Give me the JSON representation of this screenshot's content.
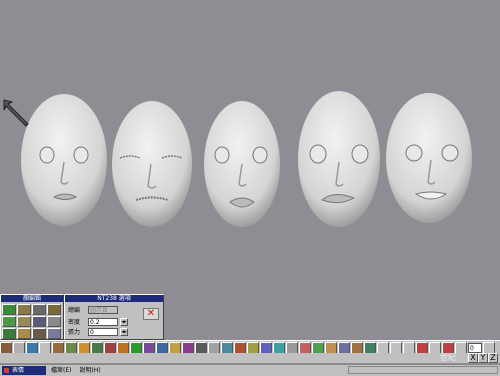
{
  "heads": [
    {
      "name": "head-neutral-1",
      "expression": "neutral"
    },
    {
      "name": "head-eyes-closed",
      "expression": "eyes-closed"
    },
    {
      "name": "head-frown",
      "expression": "frown"
    },
    {
      "name": "head-twisted-mouth",
      "expression": "twisted-mouth"
    },
    {
      "name": "head-smile",
      "expression": "smile"
    }
  ],
  "left_panel": {
    "title": "顏編輯"
  },
  "right_panel": {
    "title": "NT238 選項",
    "row1": {
      "label": "總編",
      "value": "圖示頁"
    },
    "row2": {
      "label": "密度",
      "value": "0.2"
    },
    "row3": {
      "label": "張力",
      "value": "0"
    }
  },
  "toolbar": {
    "frame_value": "0"
  },
  "axes": [
    "X",
    "Y",
    "Z"
  ],
  "status": {
    "mode": "表情",
    "menu1": "檔案(E)",
    "menu2": "說明(H)"
  },
  "watermark": "世紀",
  "colors": {
    "background": "#8f8d93",
    "panel": "#c0c0c0",
    "titlebar": "#1d2b7a"
  }
}
